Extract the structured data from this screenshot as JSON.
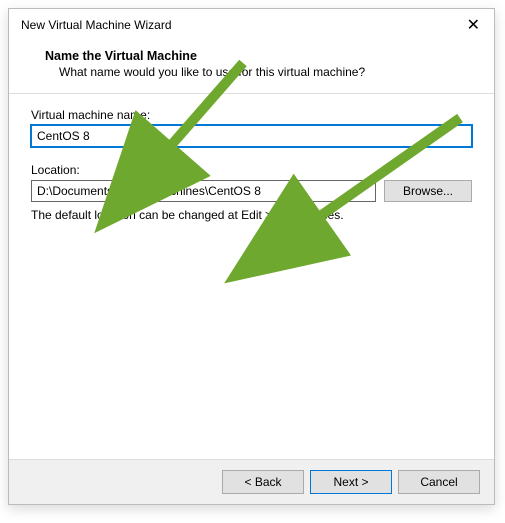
{
  "titlebar": {
    "title": "New Virtual Machine Wizard",
    "close": "✕"
  },
  "header": {
    "title": "Name the Virtual Machine",
    "subtitle": "What name would you like to use for this virtual machine?"
  },
  "form": {
    "vm_name_label": "Virtual machine name:",
    "vm_name_value": "CentOS 8",
    "location_label": "Location:",
    "location_value": "D:\\Documents\\Virtual Machines\\CentOS 8",
    "browse_label": "Browse...",
    "hint": "The default location can be changed at Edit > Preferences."
  },
  "footer": {
    "back": "< Back",
    "next": "Next >",
    "cancel": "Cancel"
  }
}
